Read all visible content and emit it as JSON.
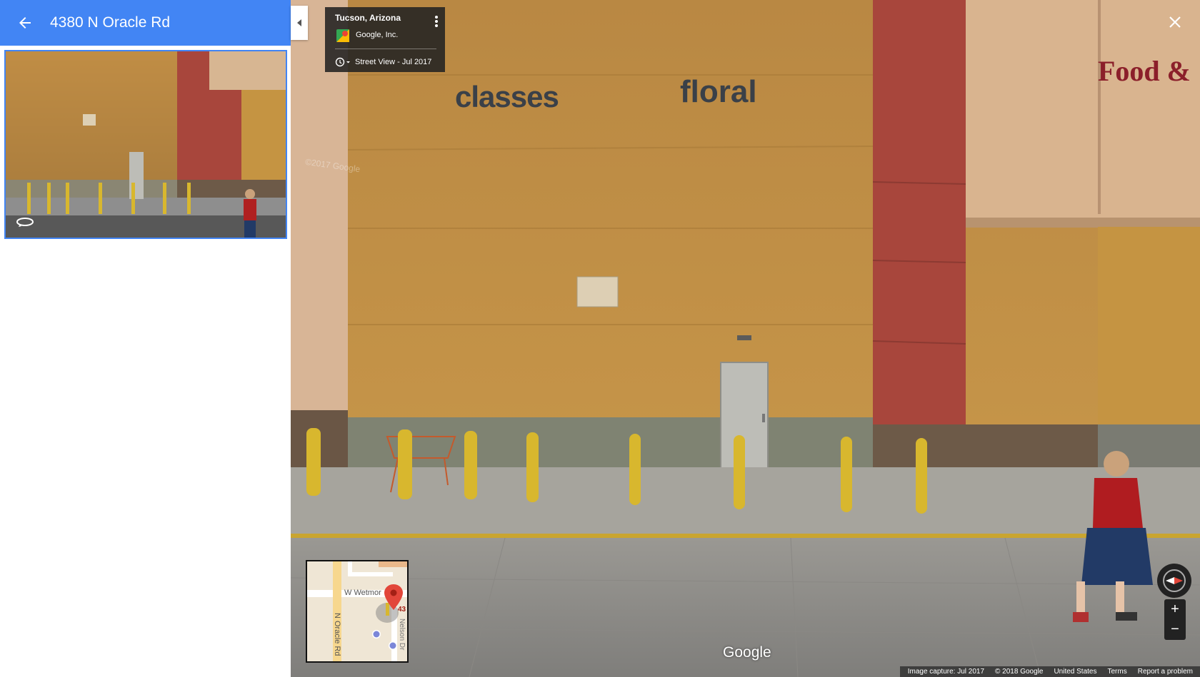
{
  "header": {
    "title": "4380 N Oracle Rd"
  },
  "info_card": {
    "location": "Tucson, Arizona",
    "owner": "Google, Inc.",
    "date": "Street View - Jul 2017"
  },
  "scene": {
    "sign_left": "classes",
    "sign_right": "floral",
    "sign_corner": "Food &",
    "watermark": "©2017 Google"
  },
  "minimap": {
    "street_horizontal": "W Wetmor",
    "street_vertical": "N Oracle Rd",
    "street_right": "Nelson Dr",
    "edge_number": "43"
  },
  "brand": {
    "logo": "Google"
  },
  "zoom": {
    "in": "+",
    "out": "−"
  },
  "footer": {
    "capture": "Image capture: Jul 2017",
    "copyright": "© 2018 Google",
    "country": "United States",
    "terms": "Terms",
    "report": "Report a problem"
  },
  "colors": {
    "header_blue": "#4285f4",
    "wall_orange": "#c08d45",
    "wall_red": "#a8463c",
    "bollard_yellow": "#d8b72e"
  }
}
